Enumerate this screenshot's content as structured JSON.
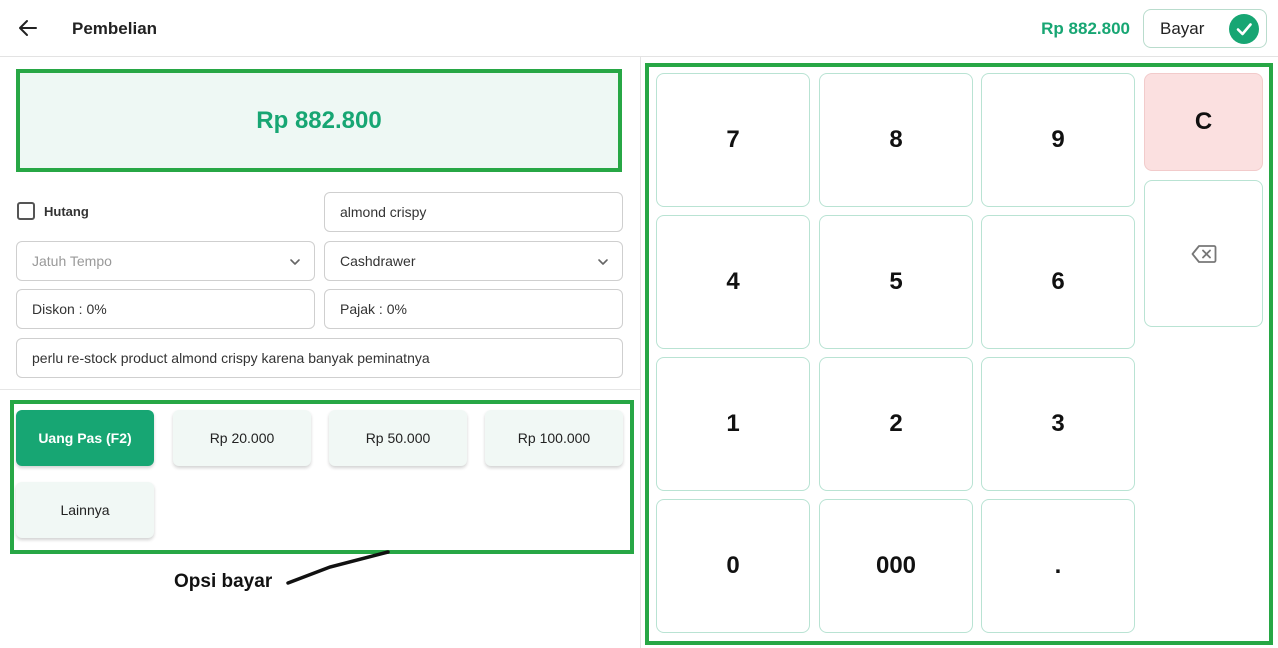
{
  "header": {
    "title": "Pembelian",
    "total": "Rp 882.800",
    "pay_label": "Bayar"
  },
  "amount": {
    "display": "Rp 882.800"
  },
  "form": {
    "hutang_label": "Hutang",
    "supplier": "almond crispy",
    "due_date_placeholder": "Jatuh Tempo",
    "cashdrawer": "Cashdrawer",
    "discount": "Diskon : 0%",
    "tax": "Pajak : 0%",
    "note": "perlu re-stock product almond crispy karena banyak peminatnya"
  },
  "payment_options": [
    {
      "label": "Uang Pas (F2)",
      "active": true
    },
    {
      "label": "Rp 20.000",
      "active": false
    },
    {
      "label": "Rp 50.000",
      "active": false
    },
    {
      "label": "Rp 100.000",
      "active": false
    },
    {
      "label": "Lainnya",
      "active": false
    }
  ],
  "annotation": {
    "label": "Opsi bayar"
  },
  "keypad": {
    "keys": [
      "7",
      "8",
      "9",
      "4",
      "5",
      "6",
      "1",
      "2",
      "3",
      "0",
      "000",
      "."
    ],
    "clear_label": "C"
  },
  "colors": {
    "accent": "#17a673",
    "highlight_frame": "#27a745",
    "clear_key_bg": "#fbe0e0"
  },
  "icons": {
    "back": "arrow-left-icon",
    "pay": "check-circle-icon",
    "dropdown": "chevron-down-icon",
    "backspace": "backspace-icon"
  }
}
